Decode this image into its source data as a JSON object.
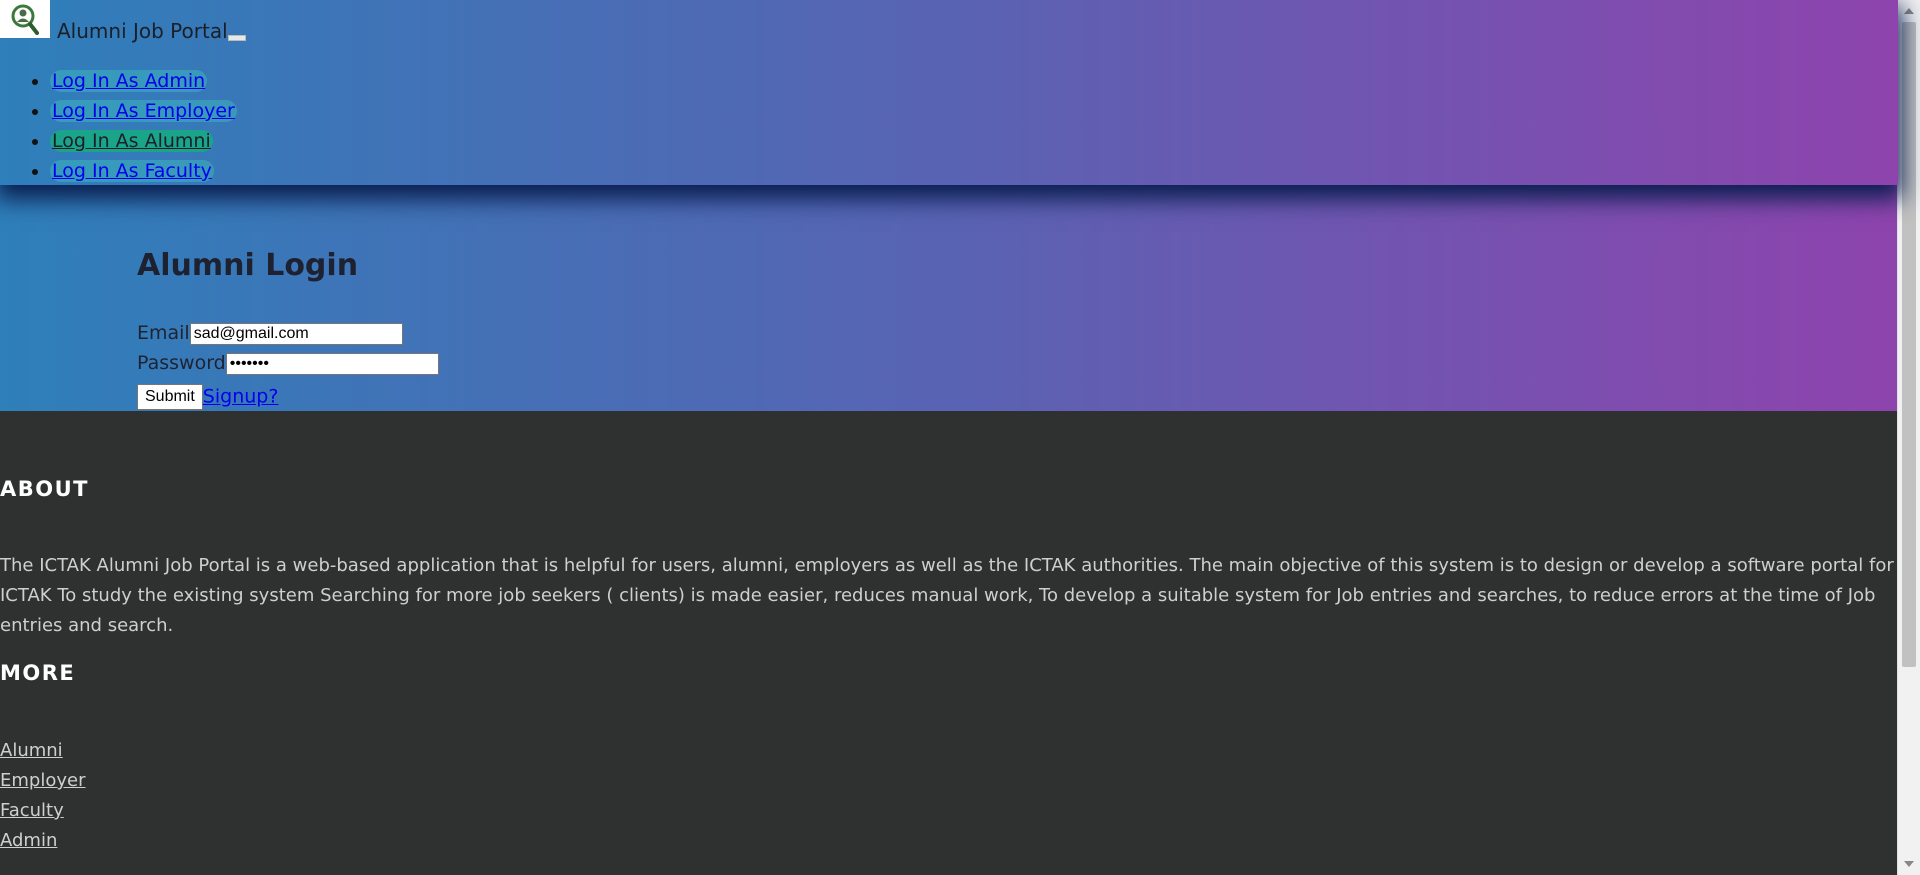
{
  "navbar": {
    "brand": "Alumni Job Portal",
    "items": [
      {
        "label": "Log In As Admin"
      },
      {
        "label": "Log In As Employer"
      },
      {
        "label": "Log In As Alumni"
      },
      {
        "label": "Log In As Faculty"
      }
    ]
  },
  "login": {
    "title": "Alumni Login",
    "email_label": "Email",
    "email_value": "sad@gmail.com",
    "password_label": "Password",
    "password_value": "•••••••",
    "submit_label": "Submit",
    "signup_label": "Signup?"
  },
  "footer": {
    "about_title": "ABOUT",
    "about_text": "The ICTAK Alumni Job Portal is a web-based application that is helpful for users, alumni, employers as well as the ICTAK authorities. The main objective of this system is to design or develop a software portal for ICTAK To study the existing system Searching for more job seekers ( clients) is made easier, reduces manual work, To develop a suitable system for Job entries and searches, to reduce errors at the time of Job entries and search.",
    "more_title": "MORE",
    "links": [
      {
        "label": "Alumni"
      },
      {
        "label": "Employer"
      },
      {
        "label": "Faculty"
      },
      {
        "label": "Admin"
      }
    ]
  },
  "colors": {
    "gradient_start": "#2e7fba",
    "gradient_end": "#8e44ad",
    "footer_bg": "#2f3030",
    "active_nav": "#1aa58a"
  }
}
